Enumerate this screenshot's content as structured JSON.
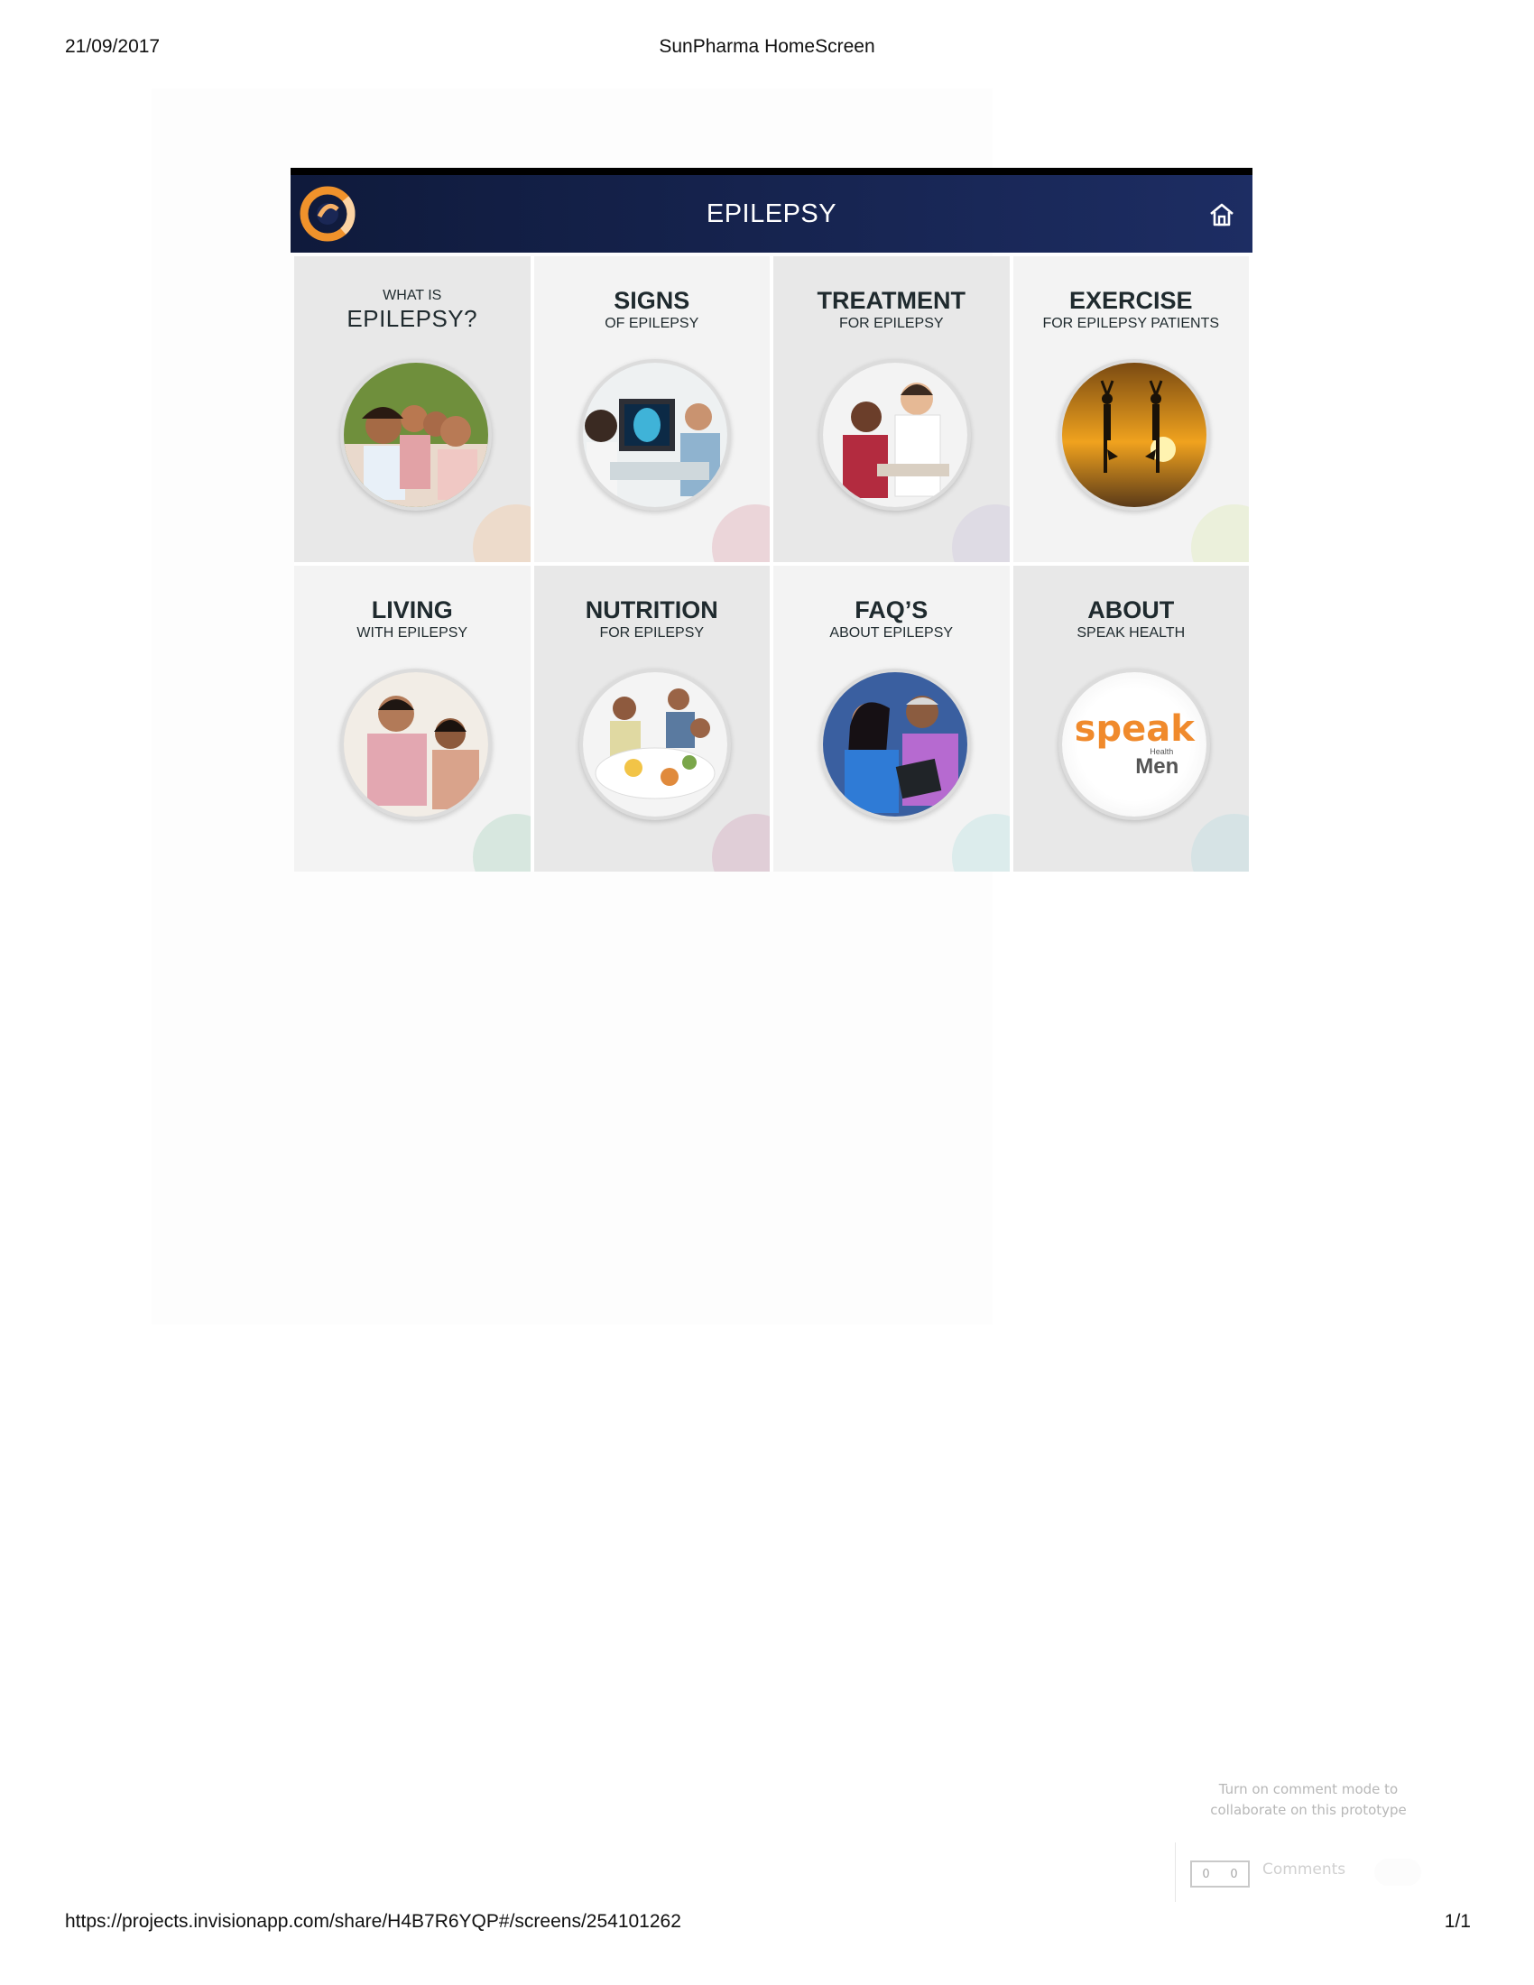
{
  "print": {
    "date": "21/09/2017",
    "title": "SunPharma HomeScreen",
    "url": "https://projects.invisionapp.com/share/H4B7R6YQP#/screens/254101262",
    "page": "1/1"
  },
  "header": {
    "title": "EPILEPSY",
    "logo_icon": "sunpharma-logo-icon",
    "home_icon": "home-icon"
  },
  "tiles": [
    {
      "id": "what-is",
      "pre": "WHAT IS",
      "title": "EPILEPSY?",
      "sub": "",
      "accent": "#f1cfb3",
      "image": "family-photo"
    },
    {
      "id": "signs",
      "pre": "",
      "title": "SIGNS",
      "sub": "OF EPILEPSY",
      "accent": "#e4bcc3",
      "image": "brain-scan-photo"
    },
    {
      "id": "treatment",
      "pre": "",
      "title": "TREATMENT",
      "sub": "FOR EPILEPSY",
      "accent": "#d6cfe0",
      "image": "doctor-consultation-photo"
    },
    {
      "id": "exercise",
      "pre": "",
      "title": "EXERCISE",
      "sub": "FOR EPILEPSY PATIENTS",
      "accent": "#e4ecc6",
      "image": "yoga-sunset-photo"
    },
    {
      "id": "living",
      "pre": "",
      "title": "LIVING",
      "sub": "WITH EPILEPSY",
      "accent": "#bfdccd",
      "image": "couple-photo"
    },
    {
      "id": "nutrition",
      "pre": "",
      "title": "NUTRITION",
      "sub": "FOR EPILEPSY",
      "accent": "#d8b8c8",
      "image": "family-dinner-photo"
    },
    {
      "id": "faqs",
      "pre": "",
      "title": "FAQ’S",
      "sub": "ABOUT EPILEPSY",
      "accent": "#c8e6e6",
      "image": "tablet-reading-photo"
    },
    {
      "id": "about",
      "pre": "",
      "title": "ABOUT",
      "sub": "SPEAK HEALTH",
      "accent": "#c6dfe1",
      "image": "speak-health-logo"
    }
  ],
  "speak_logo": {
    "word": "speak",
    "health": "Health",
    "men": "Men"
  },
  "comments": {
    "hint_line1": "Turn on comment mode to",
    "hint_line2": "collaborate on this prototype",
    "count_a": "0",
    "count_b": "0",
    "label": "Comments"
  },
  "colors": {
    "header_start": "#0f1a3b",
    "header_end": "#1d2d63",
    "logo_orange": "#f0922b"
  }
}
